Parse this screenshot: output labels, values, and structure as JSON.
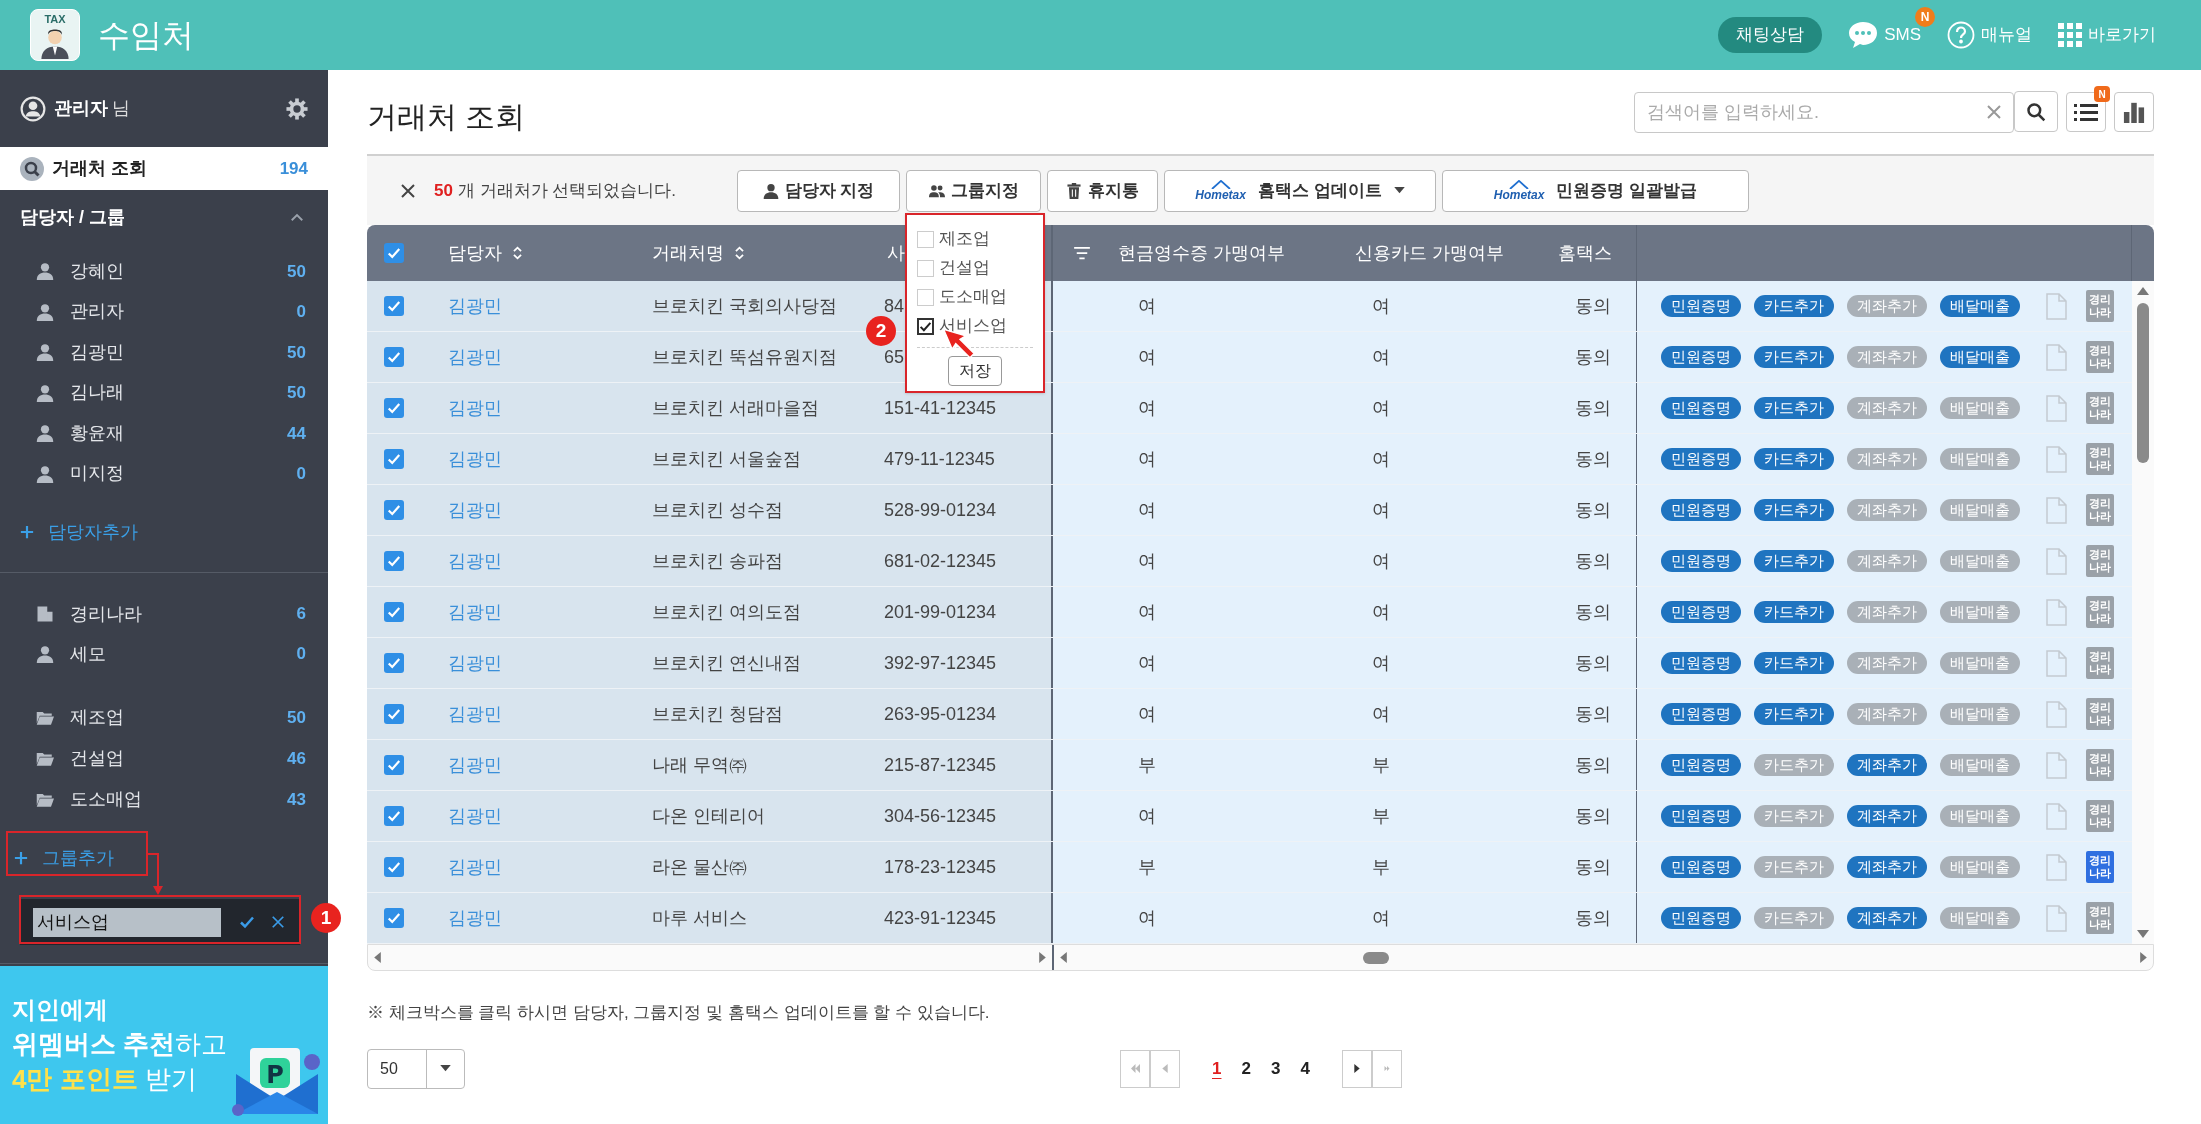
{
  "header": {
    "logo_text": "TAX",
    "title": "수임처",
    "chat_button": "채팅상담",
    "sms": {
      "label": "SMS",
      "badge": "N"
    },
    "manual": "매뉴얼",
    "shortcuts": "바로가기"
  },
  "sidebar": {
    "user": {
      "name": "관리자",
      "suffix": "님"
    },
    "nav": {
      "label": "거래처 조회",
      "count": "194",
      "selected": true
    },
    "section": {
      "title": "담당자 / 그룹",
      "expanded": true
    },
    "staff": [
      {
        "label": "강혜인",
        "count": "50"
      },
      {
        "label": "관리자",
        "count": "0"
      },
      {
        "label": "김광민",
        "count": "50"
      },
      {
        "label": "김나래",
        "count": "50"
      },
      {
        "label": "황윤재",
        "count": "44"
      },
      {
        "label": "미지정",
        "count": "0"
      }
    ],
    "add_staff": "담당자추가",
    "companies": [
      {
        "kind": "building",
        "label": "경리나라",
        "count": "6"
      },
      {
        "kind": "person",
        "label": "세모",
        "count": "0"
      }
    ],
    "groups": [
      {
        "label": "제조업",
        "count": "50"
      },
      {
        "label": "건설업",
        "count": "46"
      },
      {
        "label": "도소매업",
        "count": "43"
      }
    ],
    "add_group": "그룹추가",
    "new_group": {
      "value": "서비스업"
    },
    "banner": {
      "lines": [
        "지인에게",
        "**위멤버스 추천**하고",
        "**4만 포인트** 받기"
      ],
      "logo_text": "P"
    }
  },
  "page": {
    "title": "거래처 조회",
    "search": {
      "placeholder": "검색어를 입력하세요."
    },
    "list_badge": "N"
  },
  "toolbar": {
    "selected_count": "50",
    "selected_text": "개 거래처가 선택되었습니다.",
    "buttons": [
      {
        "kind": "manager",
        "label": "담당자 지정"
      },
      {
        "kind": "group",
        "label": "그룹지정"
      },
      {
        "kind": "trash",
        "label": "휴지통"
      },
      {
        "kind": "hometax_menu",
        "logo": "Hometax",
        "label": "홈택스 업데이트"
      },
      {
        "kind": "hometax",
        "logo": "Hometax",
        "label": "민원증명 일괄발급"
      }
    ],
    "group_menu": {
      "open": true,
      "options": [
        {
          "label": "제조업",
          "checked": false
        },
        {
          "label": "건설업",
          "checked": false
        },
        {
          "label": "도소매업",
          "checked": false
        },
        {
          "label": "서비스업",
          "checked": true
        }
      ],
      "save": "저장"
    }
  },
  "table": {
    "header_checked": true,
    "columns": [
      {
        "kind": "text",
        "label": "담당자",
        "sortable": true
      },
      {
        "kind": "text",
        "label": "거래처명",
        "sortable": true
      },
      {
        "kind": "text",
        "label": "사",
        "sortable": false
      },
      {
        "kind": "filter"
      },
      {
        "kind": "text",
        "label": "현금영수증 가맹여부",
        "sortable": false
      },
      {
        "kind": "text",
        "label": "신용카드 가맹여부",
        "sortable": false
      },
      {
        "kind": "text",
        "label": "홈택스",
        "sortable": false
      }
    ],
    "rows": [
      {
        "checked": true,
        "manager": "김광민",
        "name": "브로치킨 국회의사당점",
        "biz_no": "84",
        "cash": "여",
        "card": "여",
        "hometax": "동의",
        "badges": [
          {
            "label": "민원증명",
            "on": true
          },
          {
            "label": "카드추가",
            "on": true
          },
          {
            "label": "계좌추가",
            "on": false
          },
          {
            "label": "배달매출",
            "on": true
          }
        ],
        "gyeongni": {
          "label": "경리나라",
          "active": false
        }
      },
      {
        "checked": true,
        "manager": "김광민",
        "name": "브로치킨 뚝섬유원지점",
        "biz_no": "65",
        "cash": "여",
        "card": "여",
        "hometax": "동의",
        "badges": [
          {
            "label": "민원증명",
            "on": true
          },
          {
            "label": "카드추가",
            "on": true
          },
          {
            "label": "계좌추가",
            "on": false
          },
          {
            "label": "배달매출",
            "on": true
          }
        ],
        "gyeongni": {
          "label": "경리나라",
          "active": false
        }
      },
      {
        "checked": true,
        "manager": "김광민",
        "name": "브로치킨 서래마을점",
        "biz_no": "151-41-12345",
        "cash": "여",
        "card": "여",
        "hometax": "동의",
        "badges": [
          {
            "label": "민원증명",
            "on": true
          },
          {
            "label": "카드추가",
            "on": true
          },
          {
            "label": "계좌추가",
            "on": false
          },
          {
            "label": "배달매출",
            "on": false
          }
        ],
        "gyeongni": {
          "label": "경리나라",
          "active": false
        }
      },
      {
        "checked": true,
        "manager": "김광민",
        "name": "브로치킨 서울숲점",
        "biz_no": "479-11-12345",
        "cash": "여",
        "card": "여",
        "hometax": "동의",
        "badges": [
          {
            "label": "민원증명",
            "on": true
          },
          {
            "label": "카드추가",
            "on": true
          },
          {
            "label": "계좌추가",
            "on": false
          },
          {
            "label": "배달매출",
            "on": false
          }
        ],
        "gyeongni": {
          "label": "경리나라",
          "active": false
        }
      },
      {
        "checked": true,
        "manager": "김광민",
        "name": "브로치킨 성수점",
        "biz_no": "528-99-01234",
        "cash": "여",
        "card": "여",
        "hometax": "동의",
        "badges": [
          {
            "label": "민원증명",
            "on": true
          },
          {
            "label": "카드추가",
            "on": true
          },
          {
            "label": "계좌추가",
            "on": false
          },
          {
            "label": "배달매출",
            "on": false
          }
        ],
        "gyeongni": {
          "label": "경리나라",
          "active": false
        }
      },
      {
        "checked": true,
        "manager": "김광민",
        "name": "브로치킨 송파점",
        "biz_no": "681-02-12345",
        "cash": "여",
        "card": "여",
        "hometax": "동의",
        "badges": [
          {
            "label": "민원증명",
            "on": true
          },
          {
            "label": "카드추가",
            "on": true
          },
          {
            "label": "계좌추가",
            "on": false
          },
          {
            "label": "배달매출",
            "on": false
          }
        ],
        "gyeongni": {
          "label": "경리나라",
          "active": false
        }
      },
      {
        "checked": true,
        "manager": "김광민",
        "name": "브로치킨 여의도점",
        "biz_no": "201-99-01234",
        "cash": "여",
        "card": "여",
        "hometax": "동의",
        "badges": [
          {
            "label": "민원증명",
            "on": true
          },
          {
            "label": "카드추가",
            "on": true
          },
          {
            "label": "계좌추가",
            "on": false
          },
          {
            "label": "배달매출",
            "on": false
          }
        ],
        "gyeongni": {
          "label": "경리나라",
          "active": false
        }
      },
      {
        "checked": true,
        "manager": "김광민",
        "name": "브로치킨 연신내점",
        "biz_no": "392-97-12345",
        "cash": "여",
        "card": "여",
        "hometax": "동의",
        "badges": [
          {
            "label": "민원증명",
            "on": true
          },
          {
            "label": "카드추가",
            "on": true
          },
          {
            "label": "계좌추가",
            "on": false
          },
          {
            "label": "배달매출",
            "on": false
          }
        ],
        "gyeongni": {
          "label": "경리나라",
          "active": false
        }
      },
      {
        "checked": true,
        "manager": "김광민",
        "name": "브로치킨 청담점",
        "biz_no": "263-95-01234",
        "cash": "여",
        "card": "여",
        "hometax": "동의",
        "badges": [
          {
            "label": "민원증명",
            "on": true
          },
          {
            "label": "카드추가",
            "on": true
          },
          {
            "label": "계좌추가",
            "on": false
          },
          {
            "label": "배달매출",
            "on": false
          }
        ],
        "gyeongni": {
          "label": "경리나라",
          "active": false
        }
      },
      {
        "checked": true,
        "manager": "김광민",
        "name": "나래 무역㈜",
        "biz_no": "215-87-12345",
        "cash": "부",
        "card": "부",
        "hometax": "동의",
        "badges": [
          {
            "label": "민원증명",
            "on": true
          },
          {
            "label": "카드추가",
            "on": false
          },
          {
            "label": "계좌추가",
            "on": true
          },
          {
            "label": "배달매출",
            "on": false
          }
        ],
        "gyeongni": {
          "label": "경리나라",
          "active": false
        }
      },
      {
        "checked": true,
        "manager": "김광민",
        "name": "다온 인테리어",
        "biz_no": "304-56-12345",
        "cash": "여",
        "card": "부",
        "hometax": "동의",
        "badges": [
          {
            "label": "민원증명",
            "on": true
          },
          {
            "label": "카드추가",
            "on": false
          },
          {
            "label": "계좌추가",
            "on": true
          },
          {
            "label": "배달매출",
            "on": false
          }
        ],
        "gyeongni": {
          "label": "경리나라",
          "active": false
        }
      },
      {
        "checked": true,
        "manager": "김광민",
        "name": "라온 물산㈜",
        "biz_no": "178-23-12345",
        "cash": "부",
        "card": "부",
        "hometax": "동의",
        "badges": [
          {
            "label": "민원증명",
            "on": true
          },
          {
            "label": "카드추가",
            "on": false
          },
          {
            "label": "계좌추가",
            "on": true
          },
          {
            "label": "배달매출",
            "on": false
          }
        ],
        "gyeongni": {
          "label": "경리나라",
          "active": true
        }
      },
      {
        "checked": true,
        "manager": "김광민",
        "name": "마루 서비스",
        "biz_no": "423-91-12345",
        "cash": "여",
        "card": "여",
        "hometax": "동의",
        "badges": [
          {
            "label": "민원증명",
            "on": true
          },
          {
            "label": "카드추가",
            "on": false
          },
          {
            "label": "계좌추가",
            "on": true
          },
          {
            "label": "배달매출",
            "on": false
          }
        ],
        "gyeongni": {
          "label": "경리나라",
          "active": false
        }
      }
    ]
  },
  "footer": {
    "note": "※ 체크박스를 클릭 하시면 담당자, 그룹지정 및 홈택스 업데이트를 할 수 있습니다.",
    "page_size": "50",
    "pages": [
      {
        "label": "1",
        "selected": true
      },
      {
        "label": "2",
        "selected": false
      },
      {
        "label": "3",
        "selected": false
      },
      {
        "label": "4",
        "selected": false
      }
    ]
  },
  "annotations": [
    {
      "kind": "badge",
      "label": "1"
    },
    {
      "kind": "badge",
      "label": "2"
    }
  ]
}
